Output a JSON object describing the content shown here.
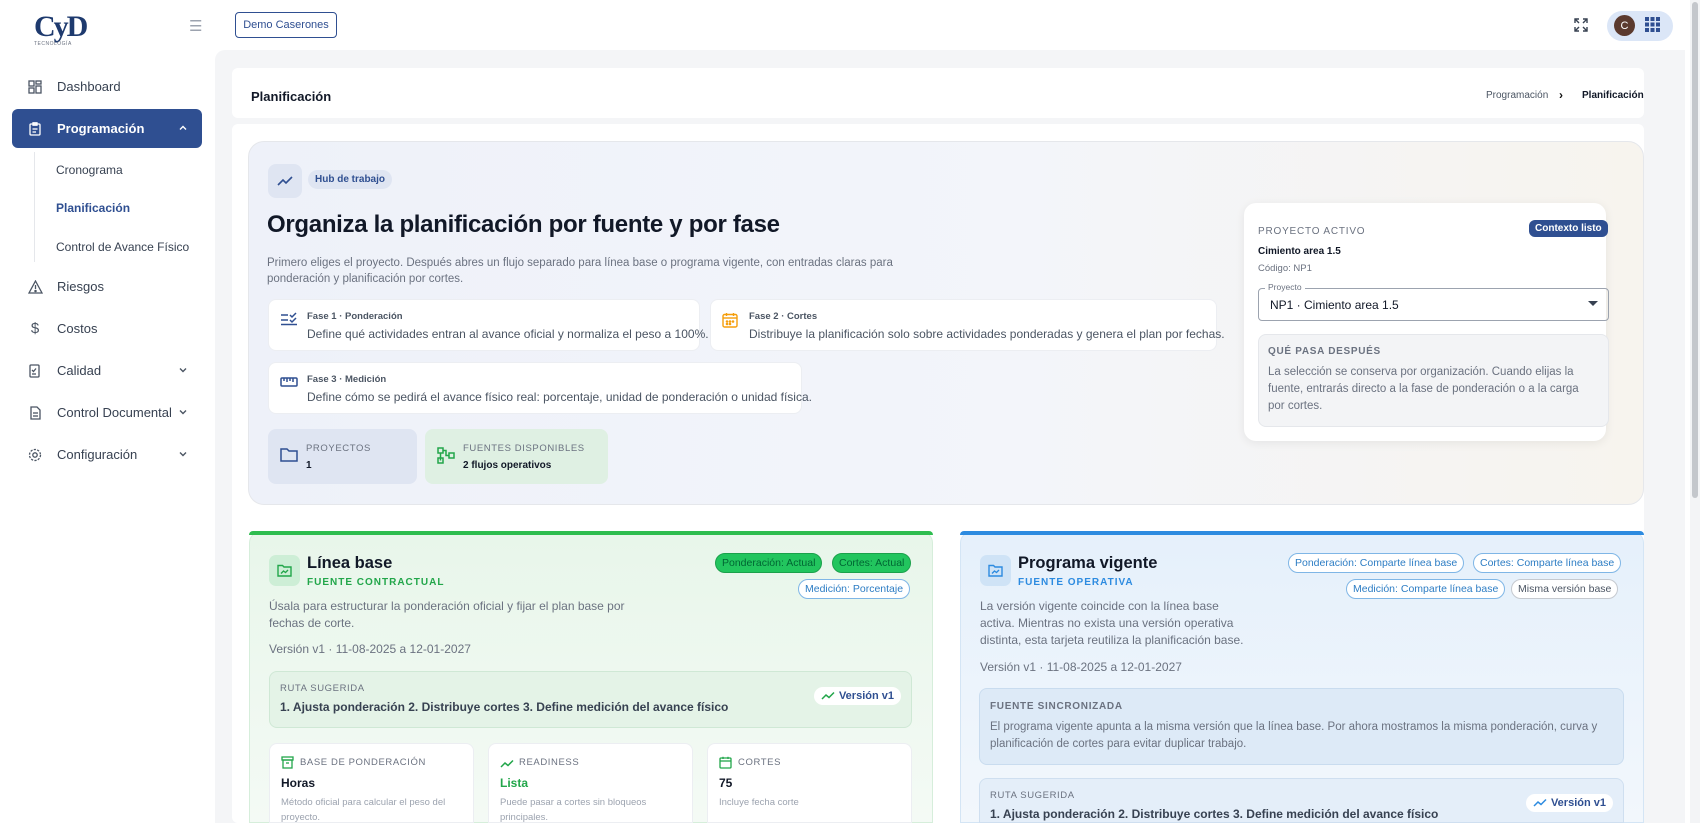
{
  "sidebar": {
    "logo_text": "CyD",
    "logo_sub": "TECNOLOGÍA",
    "items": [
      {
        "label": "Dashboard"
      },
      {
        "label": "Programación"
      },
      {
        "label": "Riesgos"
      },
      {
        "label": "Costos"
      },
      {
        "label": "Calidad"
      },
      {
        "label": "Control Documental"
      },
      {
        "label": "Configuración"
      }
    ],
    "subitems": [
      {
        "label": "Cronograma"
      },
      {
        "label": "Planificación"
      },
      {
        "label": "Control de Avance Físico"
      }
    ]
  },
  "topbar": {
    "project_button": "Demo Caserones",
    "avatar_initial": "C"
  },
  "header": {
    "title": "Planificación",
    "breadcrumb": [
      "Programación",
      "Planificación"
    ]
  },
  "hero": {
    "tag": "Hub de trabajo",
    "title": "Organiza la planificación por fuente y por fase",
    "description": "Primero eliges el proyecto. Después abres un flujo separado para línea base o programa vigente, con entradas claras para ponderación y planificación por cortes.",
    "phases": [
      {
        "title": "Fase 1 · Ponderación",
        "desc": "Define qué actividades entran al avance oficial y normaliza el peso a 100%."
      },
      {
        "title": "Fase 2 · Cortes",
        "desc": "Distribuye la planificación solo sobre actividades ponderadas y genera el plan por fechas."
      },
      {
        "title": "Fase 3 · Medición",
        "desc": "Define cómo se pedirá el avance físico real: porcentaje, unidad de ponderación o unidad física."
      }
    ],
    "stats": [
      {
        "label": "PROYECTOS",
        "value": "1"
      },
      {
        "label": "FUENTES DISPONIBLES",
        "value": "2 flujos operativos"
      }
    ]
  },
  "project_panel": {
    "label": "PROYECTO ACTIVO",
    "badge": "Contexto listo",
    "name": "Cimiento area 1.5",
    "code": "Código: NP1",
    "select_label": "Proyecto",
    "select_value": "NP1 · Cimiento area 1.5",
    "next_title": "QUÉ PASA DESPUÉS",
    "next_desc": "La selección se conserva por organización. Cuando elijas la fuente, entrarás directo a la fase de ponderación o a la carga por cortes."
  },
  "linea_base": {
    "title": "Línea base",
    "subtitle": "FUENTE CONTRACTUAL",
    "chips": [
      "Ponderación: Actual",
      "Cortes: Actual",
      "Medición: Porcentaje"
    ],
    "description": "Úsala para estructurar la ponderación oficial y fijar el plan base por fechas de corte.",
    "version": "Versión v1 · 11-08-2025 a 12-01-2027",
    "route_label": "RUTA SUGERIDA",
    "route_value": "1. Ajusta ponderación 2. Distribuye cortes 3. Define medición del avance físico",
    "version_badge": "Versión v1",
    "minis": [
      {
        "label": "BASE DE PONDERACIÓN",
        "value": "Horas",
        "desc": "Método oficial para calcular el peso del proyecto."
      },
      {
        "label": "READINESS",
        "value": "Lista",
        "desc": "Puede pasar a cortes sin bloqueos principales."
      },
      {
        "label": "CORTES",
        "value": "75",
        "desc": "Incluye fecha corte"
      }
    ]
  },
  "programa_vigente": {
    "title": "Programa vigente",
    "subtitle": "FUENTE OPERATIVA",
    "chips": [
      "Ponderación: Comparte línea base",
      "Cortes: Comparte línea base",
      "Medición: Comparte línea base",
      "Misma versión base"
    ],
    "description": "La versión vigente coincide con la línea base activa. Mientras no exista una versión operativa distinta, esta tarjeta reutiliza la planificación base.",
    "version": "Versión v1 · 11-08-2025 a 12-01-2027",
    "sync_title": "FUENTE SINCRONIZADA",
    "sync_desc": "El programa vigente apunta a la misma versión que la línea base. Por ahora mostramos la misma ponderación, curva y planificación de cortes para evitar duplicar trabajo.",
    "route_label": "RUTA SUGERIDA",
    "route_value": "1. Ajusta ponderación 2. Distribuye cortes 3. Define medición del avance físico",
    "version_badge": "Versión v1"
  },
  "colors": {
    "primary": "#2f4f91",
    "green": "#22c55e",
    "blue": "#2d8be0"
  }
}
